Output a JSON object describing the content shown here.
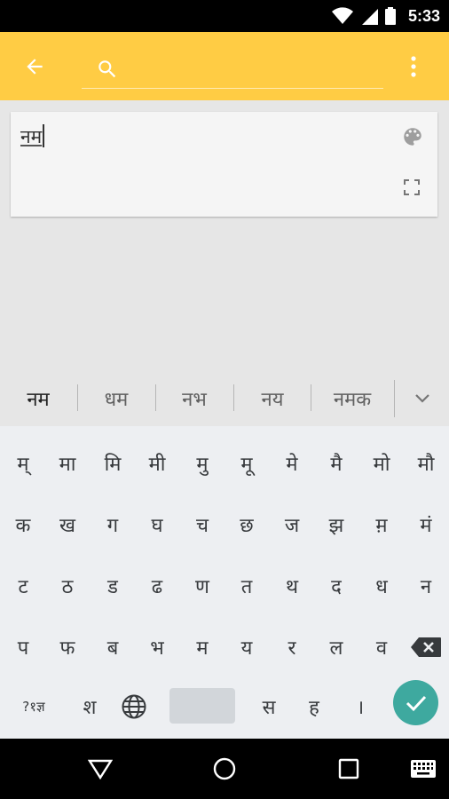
{
  "status_bar": {
    "time": "5:33",
    "icons": [
      "wifi-icon",
      "signal-icon",
      "battery-icon"
    ]
  },
  "app_bar": {
    "icons": [
      "arrow-back-icon",
      "search-icon",
      "more-vert-icon"
    ],
    "search_value": "",
    "color": "#ffcc44"
  },
  "compose": {
    "text": "नम",
    "icons": [
      "palette-icon",
      "fullscreen-icon"
    ]
  },
  "suggestions": {
    "items": [
      "नम",
      "धम",
      "नभ",
      "नय",
      "नमक"
    ],
    "expand_icon": "chevron-down-icon"
  },
  "keyboard": {
    "rows": [
      [
        "म्",
        "मा",
        "मि",
        "मी",
        "मु",
        "मू",
        "मे",
        "मै",
        "मो",
        "मौ"
      ],
      [
        "क",
        "ख",
        "ग",
        "घ",
        "च",
        "छ",
        "ज",
        "झ",
        "म़",
        "मं"
      ],
      [
        "ट",
        "ठ",
        "ड",
        "ढ",
        "ण",
        "त",
        "थ",
        "द",
        "ध",
        "न"
      ],
      [
        "प",
        "फ",
        "ब",
        "भ",
        "म",
        "य",
        "र",
        "ल",
        "व"
      ]
    ],
    "bottom_row": {
      "symbols_label": "?१ज्ञ",
      "sha": "श",
      "sa": "स",
      "ha": "ह",
      "danda": "।"
    },
    "enter_color": "#3ea99f"
  },
  "nav_bar": {
    "icons": [
      "back-triangle-icon",
      "home-circle-icon",
      "recents-square-icon",
      "keyboard-switch-icon"
    ]
  }
}
